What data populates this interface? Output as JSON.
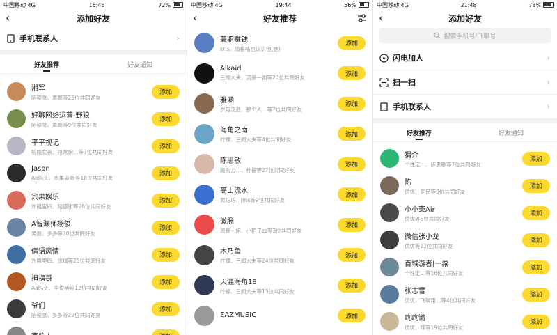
{
  "phone1": {
    "status": {
      "carrier": "中国移动",
      "network": "4G",
      "time": "16:45",
      "battery": "72%"
    },
    "title": "添加好友",
    "contacts_entry": "手机联系人",
    "tabs": [
      "好友推荐",
      "好友通知"
    ],
    "items": [
      {
        "name": "湘军",
        "sub": "陌德张、黄磊等25位共同好友",
        "color": "#c98a5a"
      },
      {
        "name": "好聊网络运营-野狼",
        "sub": "陌德张、黄磊等9位共同好友",
        "color": "#7a8e4c"
      },
      {
        "name": "平平视记",
        "sub": "鲸雨女孩、段常貌…等7位共同好友",
        "color": "#b7b5c8"
      },
      {
        "name": "Jason",
        "sub": "Aa码头、水果😀😍等18位共同好友",
        "color": "#2b2b2b"
      },
      {
        "name": "宾果娱乐",
        "sub": "外賤里四、陌德张等28位共同好友",
        "color": "#d86a5c"
      },
      {
        "name": "A智渊师杨俊",
        "sub": "黄磊、多多等20位共同好友",
        "color": "#6a84a8"
      },
      {
        "name": "倩语风情",
        "sub": "外賤里四、张瑞等25位共同好友",
        "color": "#3f6fa0"
      },
      {
        "name": "拇指哥",
        "sub": "Aa码头、李俊明等12位共同好友",
        "color": "#b3561f"
      },
      {
        "name": "爷们",
        "sub": "陌德张、多多等29位共同好友",
        "color": "#3c3c3c"
      },
      {
        "name": "宇航人",
        "sub": "",
        "color": "#888888"
      }
    ],
    "add_label": "添加"
  },
  "phone2": {
    "status": {
      "carrier": "中国移动",
      "network": "4G",
      "time": "19:44",
      "battery": "56%"
    },
    "title": "好友推荐",
    "items": [
      {
        "name": "兼职赚钱",
        "sub": "kris、晴格格也认识他(她)",
        "color": "#5a7ec4"
      },
      {
        "name": "Alkaid",
        "sub": "三闻大夫、流暴一姐等20位共同好友",
        "color": "#111111"
      },
      {
        "name": "雅涵",
        "sub": "岁月流逝、那个人…等7位共同好友",
        "color": "#8a6a4e"
      },
      {
        "name": "海角之南",
        "sub": "柠檬、三闻大夫等4位共同好友",
        "color": "#6aa6c8"
      },
      {
        "name": "陈思敏",
        "sub": "趣购力…、柠檬等27位共同好友",
        "color": "#d8b8a8"
      },
      {
        "name": "高山流水",
        "sub": "黄巧巧、jms等9位共同好友",
        "color": "#3a6fd0"
      },
      {
        "name": "微脉",
        "sub": "流暴一姐、小稻子zz等3位共同好友",
        "color": "#ee4b4b"
      },
      {
        "name": "木乃鱼",
        "sub": "柠檬、三闻大夫等24位共同好友",
        "color": "#444444"
      },
      {
        "name": "天涯海角18",
        "sub": "柠檬、三闻大夫等13位共同好友",
        "color": "#2f3a55"
      },
      {
        "name": "EAZMUSIC",
        "sub": "",
        "color": "#999999"
      }
    ],
    "add_label": "添加"
  },
  "phone3": {
    "status": {
      "carrier": "中国移动",
      "network": "4G",
      "time": "21:48",
      "battery": "78%"
    },
    "title": "添加好友",
    "search_placeholder": "搜索手机号/飞聊号",
    "entries": [
      "闪电加人",
      "扫一扫",
      "手机联系人"
    ],
    "tabs": [
      "好友推荐",
      "好友通知"
    ],
    "items": [
      {
        "name": "猬介",
        "sub": "个性定…、陈思敏等7位共同好友",
        "color": "#2bb673"
      },
      {
        "name": "陈",
        "sub": "优优、家民等9位共同好友",
        "color": "#7a6a5a"
      },
      {
        "name": "小小東Air",
        "sub": "优优等6位共同好友",
        "color": "#4a4a4a"
      },
      {
        "name": "微信张小龙",
        "sub": "优优等22位共同好友",
        "color": "#3d3d3d"
      },
      {
        "name": "百城游者|一粟",
        "sub": "个性定…等16位共同好友",
        "color": "#6c8a9a"
      },
      {
        "name": "张志雪",
        "sub": "优优、飞聊用…等4位共同好友",
        "color": "#5a7aa0"
      },
      {
        "name": "咚咚锵",
        "sub": "优优、咪等19位共同好友",
        "color": "#c9b89a"
      }
    ],
    "add_label": "添加"
  }
}
